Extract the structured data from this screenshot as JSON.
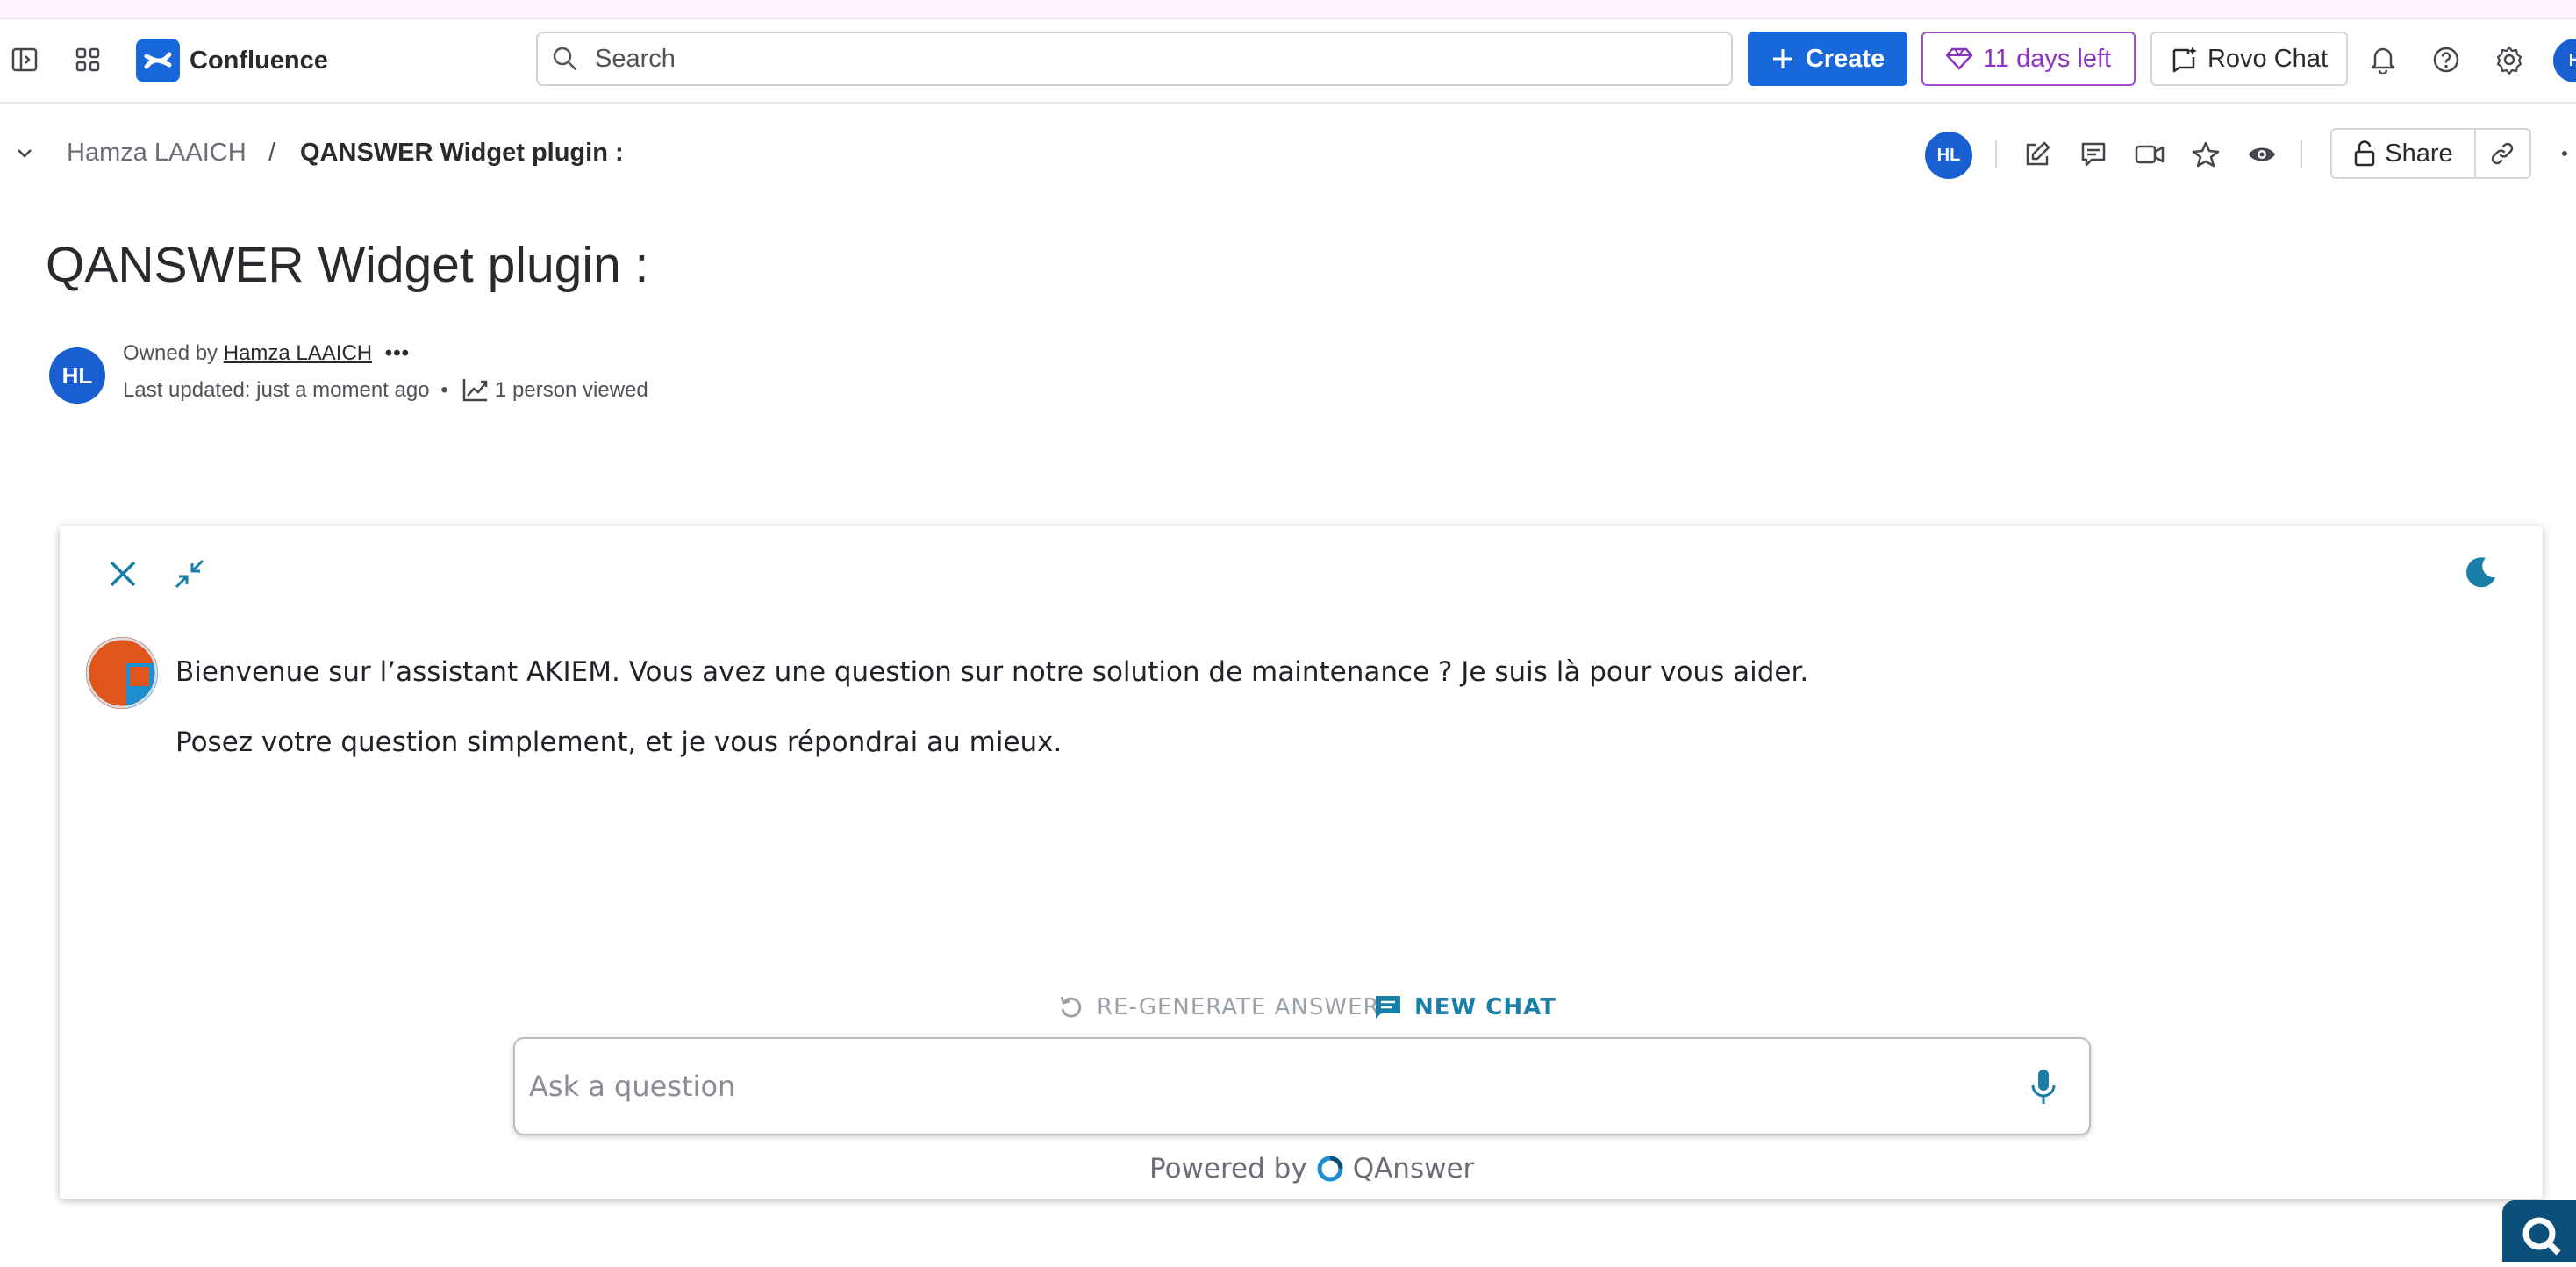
{
  "app": {
    "brand": "Confluence",
    "search_placeholder": "Search",
    "create_label": "Create",
    "trial_label": "11 days left",
    "rovo_label": "Rovo Chat",
    "user_initial": "H"
  },
  "breadcrumb": {
    "parent": "Hamza LAAICH",
    "separator": "/",
    "current": "QANSWER Widget plugin :"
  },
  "page_actions": {
    "avatar_initials": "HL",
    "share_label": "Share"
  },
  "page": {
    "title": "QANSWER Widget plugin :",
    "owner_prefix": "Owned by",
    "owner_name": "Hamza LAAICH",
    "more": "•••",
    "last_updated": "Last updated: just a moment ago",
    "bullet": "•",
    "views": "1 person viewed",
    "avatar_initials": "HL"
  },
  "widget": {
    "message_1": "Bienvenue sur l’assistant AKIEM. Vous avez une question sur notre solution de maintenance ? Je suis là pour vous aider.",
    "message_2": "Posez votre question simplement, et je vous répondrai au mieux.",
    "regenerate_label": "RE-GENERATE ANSWER",
    "new_chat_label": "NEW CHAT",
    "input_placeholder": "Ask a question",
    "powered_by": "Powered by",
    "powered_brand": "QAnswer",
    "colors": {
      "accent": "#1a7fa8",
      "bot_orange": "#e0551a",
      "bot_blue": "#1b8fcf"
    }
  },
  "colors": {
    "primary": "#1868db",
    "trial": "#8a33c4"
  }
}
